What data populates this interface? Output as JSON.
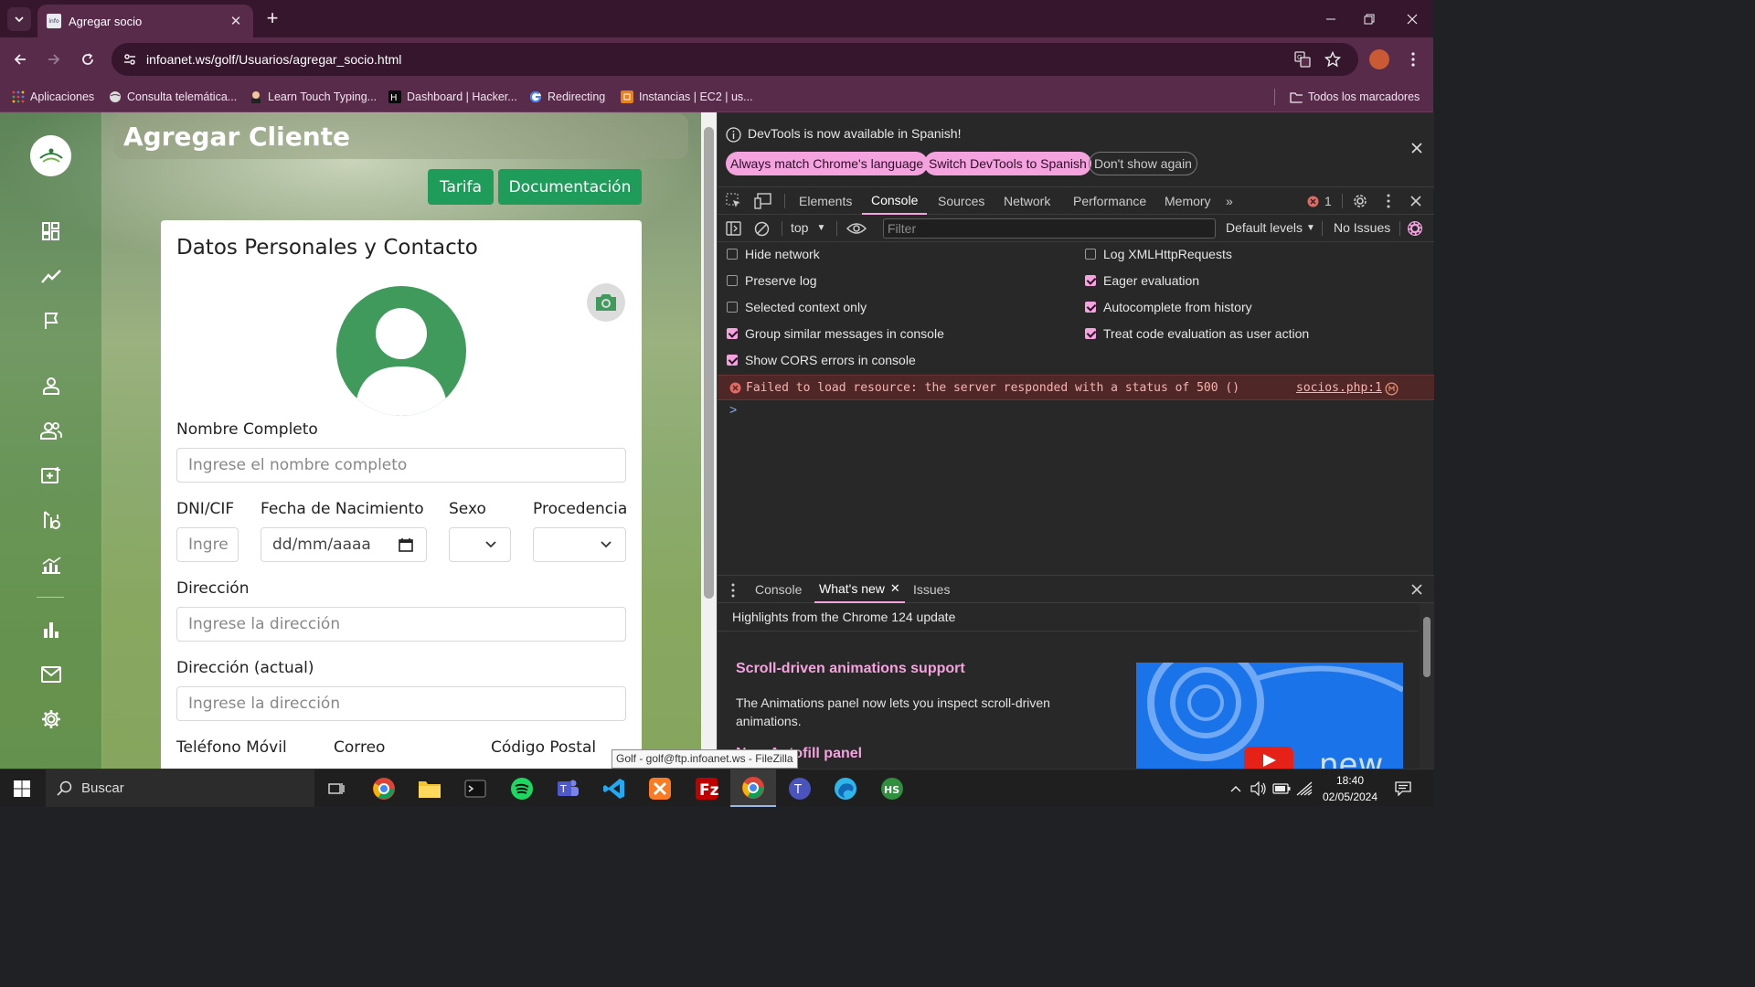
{
  "browser": {
    "tab_title": "Agregar socio",
    "url": "infoanet.ws/golf/Usuarios/agregar_socio.html",
    "bookmarks": [
      {
        "label": "Aplicaciones",
        "icon": "apps-grid-icon"
      },
      {
        "label": "Consulta telemática...",
        "icon": "globe-icon"
      },
      {
        "label": "Learn Touch Typing...",
        "icon": "typing-icon"
      },
      {
        "label": "Dashboard | Hacker...",
        "icon": "hackerrank-icon"
      },
      {
        "label": "Redirecting",
        "icon": "google-icon"
      },
      {
        "label": "Instancias | EC2 | us...",
        "icon": "aws-icon"
      }
    ],
    "all_bookmarks": "Todos los marcadores"
  },
  "page": {
    "logo_text": "GOLF LOGO",
    "header_title": "Agregar Cliente",
    "buttons": {
      "tarifa": "Tarifa",
      "documentacion": "Documentación"
    },
    "card_title": "Datos Personales y Contacto",
    "fields": {
      "nombre_label": "Nombre Completo",
      "nombre_placeholder": "Ingrese el nombre completo",
      "dni_label": "DNI/CIF",
      "dni_placeholder": "Ingre",
      "fecha_label": "Fecha de Nacimiento",
      "fecha_placeholder": "dd/mm/aaaa",
      "sexo_label": "Sexo",
      "procedencia_label": "Procedencia",
      "direccion_label": "Dirección",
      "direccion_placeholder": "Ingrese la dirección",
      "direccion_actual_label": "Dirección (actual)",
      "direccion_actual_placeholder": "Ingrese la dirección",
      "telefono_label": "Teléfono Móvil",
      "correo_label": "Correo",
      "cp_label": "Código Postal"
    },
    "tooltip": "Golf - golf@ftp.infoanet.ws - FileZilla"
  },
  "devtools": {
    "info_message": "DevTools is now available in Spanish!",
    "info_buttons": [
      "Always match Chrome's language",
      "Switch DevTools to Spanish",
      "Don't show again"
    ],
    "tabs": [
      "Elements",
      "Console",
      "Sources",
      "Network",
      "Performance",
      "Memory"
    ],
    "error_count": "1",
    "context": "top",
    "filter_placeholder": "Filter",
    "levels": "Default levels",
    "issues": "No Issues",
    "settings": [
      {
        "label": "Hide network",
        "checked": false
      },
      {
        "label": "Log XMLHttpRequests",
        "checked": false
      },
      {
        "label": "Preserve log",
        "checked": false
      },
      {
        "label": "Eager evaluation",
        "checked": true
      },
      {
        "label": "Selected context only",
        "checked": false
      },
      {
        "label": "Autocomplete from history",
        "checked": true
      },
      {
        "label": "Group similar messages in console",
        "checked": true
      },
      {
        "label": "Treat code evaluation as user action",
        "checked": true
      },
      {
        "label": "Show CORS errors in console",
        "checked": true
      }
    ],
    "error_message": "Failed to load resource: the server responded with a status of 500 ()",
    "error_source": "socios.php:1",
    "prompt": ">",
    "drawer_tabs": [
      "Console",
      "What's new",
      "Issues"
    ],
    "whats_new": {
      "heading": "Highlights from the Chrome 124 update",
      "title": "Scroll-driven animations support",
      "body": "The Animations panel now lets you inspect scroll-driven animations.",
      "title2": "New Autofill panel",
      "image_text": "new"
    }
  },
  "taskbar": {
    "search": "Buscar",
    "time": "18:40",
    "date": "02/05/2024"
  },
  "colors": {
    "chrome_frame": "#35162d",
    "chrome_toolbar": "#582b4b",
    "green_button": "#1f9c5a",
    "avatar_green": "#3f9a5b",
    "devtools_accent": "#f4a3df",
    "error_bg": "#4e2726"
  }
}
